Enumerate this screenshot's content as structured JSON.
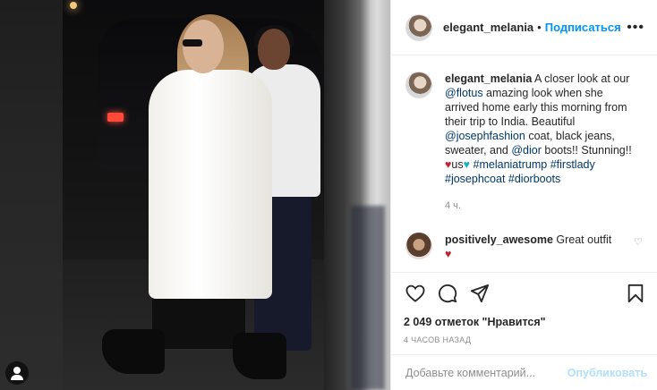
{
  "post": {
    "username": "elegant_melania",
    "follow_label": "Подписаться",
    "dot": "•",
    "more_label": "•••"
  },
  "caption": {
    "username": "elegant_melania",
    "part1": " A closer look at our ",
    "mention1": "@flotus",
    "part2": " amazing look when she arrived home early this morning from their trip to India. Beautiful ",
    "mention2": "@josephfashion",
    "part3": " coat, black jeans, sweater, and ",
    "mention3": "@dior",
    "part4": " boots!! Stunning!! ",
    "heart1": "♥",
    "us": "us",
    "heart2": "♥",
    "tag1": "#melaniatrump",
    "tag2": "#firstlady",
    "tag3": "#josephcoat",
    "tag4": "#diorboots",
    "time": "4 ч."
  },
  "comment": {
    "username": "positively_awesome",
    "text": "Great outfit",
    "heart": "♥",
    "like_icon": "♡"
  },
  "actions": {
    "likes": "2 049 отметок \"Нравится\"",
    "posted": "4 ЧАСОВ НАЗАД"
  },
  "add_comment": {
    "placeholder": "Добавьте комментарий...",
    "publish_label": "Опубликовать"
  },
  "icons": [
    "user-icon",
    "heart-icon",
    "comment-icon",
    "share-icon",
    "bookmark-icon"
  ]
}
